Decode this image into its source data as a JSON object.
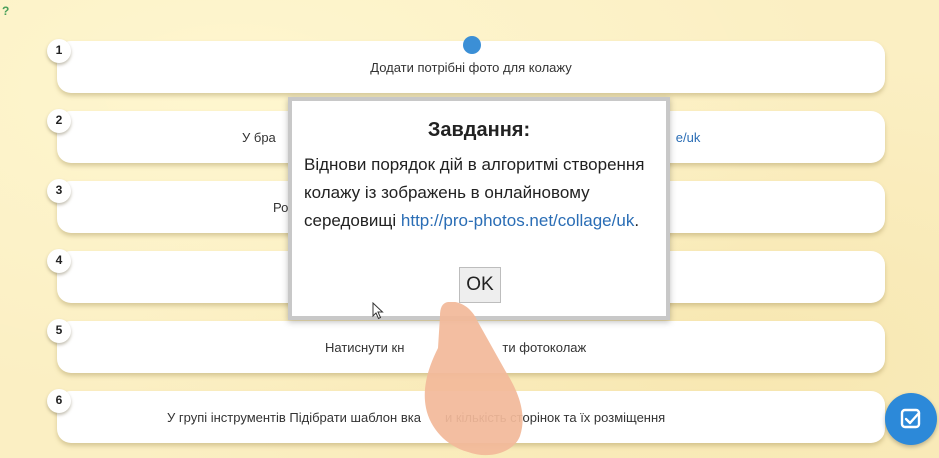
{
  "rows": [
    {
      "num": "1",
      "text": "Додати потрібні фото для колажу"
    },
    {
      "num": "2",
      "text": "У бра",
      "link_tail": "e/uk",
      "tail_hidden": true
    },
    {
      "num": "3",
      "text": "Ро"
    },
    {
      "num": "4",
      "text": ""
    },
    {
      "num": "5",
      "text_left": "Натиснути кн",
      "text_right": "ти фотоколаж"
    },
    {
      "num": "6",
      "text_left": "У групі інструментів Підібрати шаблон вка",
      "text_right": "и кількість сторінок та їх розміщення"
    }
  ],
  "modal": {
    "title": "Завдання:",
    "body_text": "Віднови порядок дій в алгоритмі створення колажу із зображень в онлайновому середовищі",
    "body_link": "http://pro-photos.net/collage/uk",
    "body_end": ".",
    "ok_label": "OK"
  },
  "colors": {
    "background": "#fbefc3",
    "accent": "#2c89d9",
    "link": "#2a6db5"
  },
  "icons": {
    "help": "question-icon",
    "check": "check-square-icon",
    "hand": "pointing-hand-icon",
    "cursor": "mouse-cursor-icon",
    "drag": "drag-handle-dot"
  }
}
